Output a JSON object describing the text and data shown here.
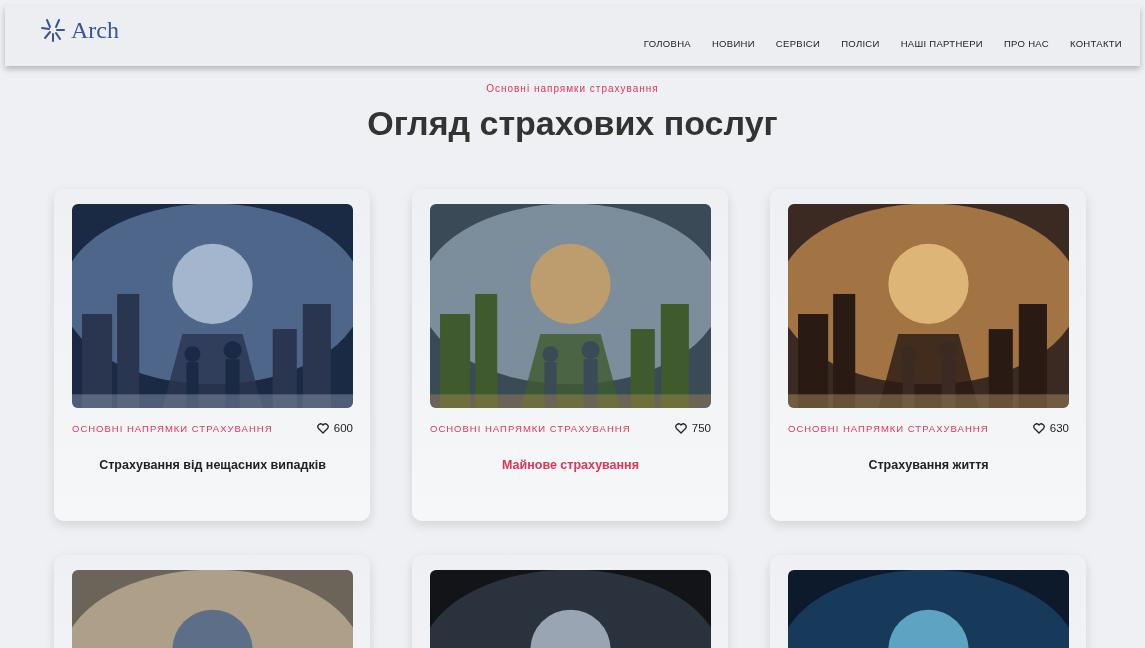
{
  "header": {
    "logo": "Arch",
    "nav": [
      {
        "label": "ГОЛОВНА"
      },
      {
        "label": "НОВИНИ"
      },
      {
        "label": "СЕРВІСИ"
      },
      {
        "label": "ПОЛІСИ"
      },
      {
        "label": "НАШІ ПАРТНЕРИ"
      },
      {
        "label": "ПРО НАС"
      },
      {
        "label": "КОНТАКТИ"
      }
    ]
  },
  "section": {
    "eyebrow": "Основні напрямки страхування",
    "title": "Огляд страхових послуг"
  },
  "cards": [
    {
      "image": {
        "kind": "picture"
      },
      "category": "ОСНОВНІ НАПРЯМКИ СТРАХУВАННЯ",
      "likes": "600",
      "title": "Страхування від нещасних випадків",
      "selected": false
    },
    {
      "image": {
        "kind": "picture"
      },
      "category": "ОСНОВНІ НАПРЯМКИ СТРАХУВАННЯ",
      "likes": "750",
      "title": "Майнове страхування",
      "selected": true
    },
    {
      "image": {
        "kind": "picture"
      },
      "category": "ОСНОВНІ НАПРЯМКИ СТРАХУВАННЯ",
      "likes": "630",
      "title": "Страхування життя",
      "selected": false
    },
    {
      "image": {
        "kind": "picture"
      }
    },
    {
      "image": {
        "kind": "picture"
      }
    },
    {
      "image": {
        "kind": "picture"
      }
    }
  ]
}
